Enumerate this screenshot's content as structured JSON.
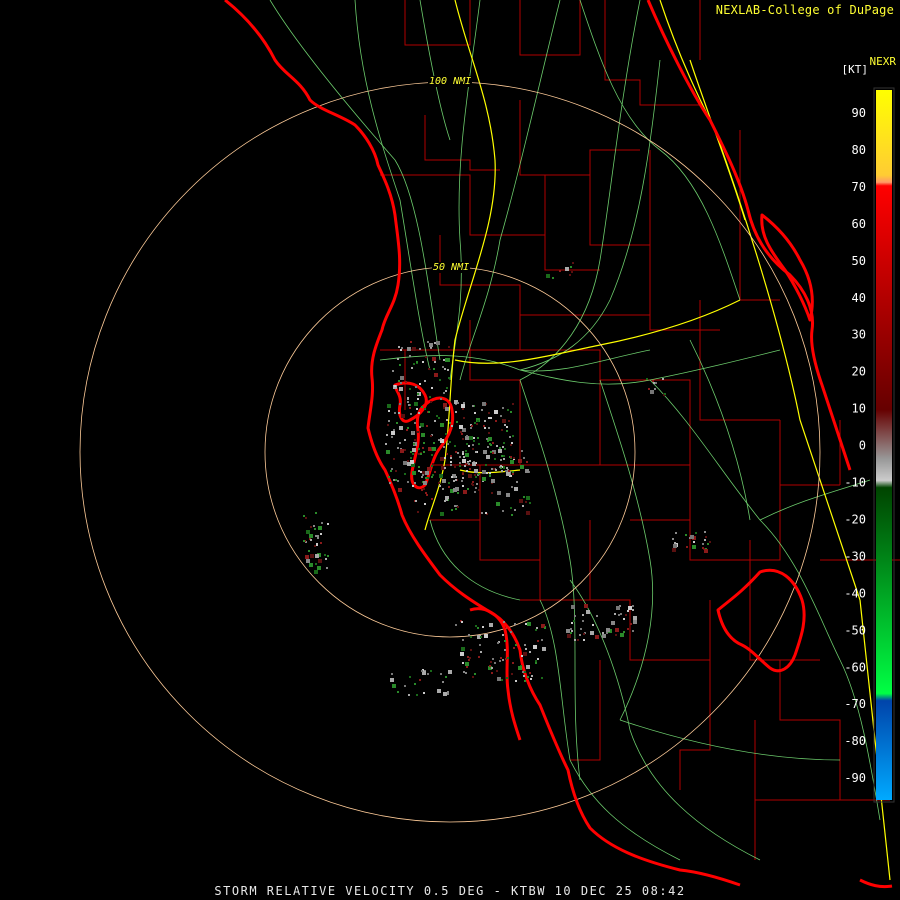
{
  "credit": "NEXLAB-College of DuPage",
  "product": "NEXR",
  "units": "[KT]",
  "title": "STORM RELATIVE VELOCITY 0.5 DEG - KTBW 10 DEC 25 08:42",
  "range_rings": [
    {
      "label": "100 NMI"
    },
    {
      "label": "50 NMI"
    }
  ],
  "legend": {
    "ticks": [
      "90",
      "80",
      "70",
      "60",
      "50",
      "40",
      "30",
      "20",
      "10",
      "0",
      "-10",
      "-20",
      "-30",
      "-40",
      "-50",
      "-60",
      "-70",
      "-80",
      "-90"
    ],
    "colors": {
      "top": "#ffff00",
      "orange": "#ff9966",
      "red": "#ff0000",
      "dark_red": "#660000",
      "near_zero": "#999999",
      "dark_green": "#004400",
      "green": "#00ff44",
      "dark_blue": "#0044aa",
      "light_blue": "#00aaff"
    }
  },
  "map_colors": {
    "coastline": "#ff0000",
    "county": "#b00000",
    "highway": "#ffff00",
    "road": "#88ff88",
    "ring": "#ffcc99"
  }
}
